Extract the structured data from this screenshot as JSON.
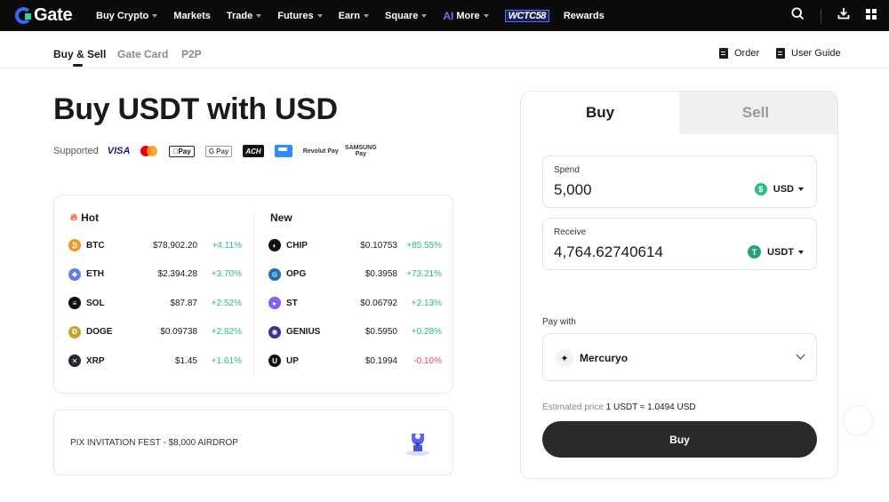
{
  "brand": {
    "name": "Gate"
  },
  "nav": {
    "items": [
      {
        "label": "Buy Crypto",
        "caret": true
      },
      {
        "label": "Markets",
        "caret": false
      },
      {
        "label": "Trade",
        "caret": true
      },
      {
        "label": "Futures",
        "caret": true
      },
      {
        "label": "Earn",
        "caret": true
      },
      {
        "label": "Square",
        "caret": true
      }
    ],
    "more_prefix": "AI",
    "more_label": "More",
    "wctc_label": "WCTC58",
    "rewards_label": "Rewards"
  },
  "tabs": {
    "buy_sell": "Buy & Sell",
    "gate_card": "Gate Card",
    "p2p": "P2P",
    "order": "Order",
    "user_guide": "User Guide"
  },
  "hero": {
    "title": "Buy USDT with USD",
    "supported_label": "Supported",
    "methods": [
      "VISA",
      "Mastercard",
      "Pay",
      "G Pay",
      "ACH",
      "Bank",
      "Revolut Pay",
      "SAMSUNG Pay"
    ]
  },
  "market": {
    "hot_label": "Hot",
    "new_label": "New",
    "hot": [
      {
        "symbol": "BTC",
        "price": "$78,902.20",
        "change": "+4.11%",
        "dir": "up",
        "color": "#f7931a",
        "glyph": "₿"
      },
      {
        "symbol": "ETH",
        "price": "$2,394.28",
        "change": "+3.70%",
        "dir": "up",
        "color": "#627eea",
        "glyph": "◆"
      },
      {
        "symbol": "SOL",
        "price": "$87.87",
        "change": "+2.52%",
        "dir": "up",
        "color": "#111111",
        "glyph": "≡"
      },
      {
        "symbol": "DOGE",
        "price": "$0.09738",
        "change": "+2.82%",
        "dir": "up",
        "color": "#c2a633",
        "glyph": "Ð"
      },
      {
        "symbol": "XRP",
        "price": "$1.45",
        "change": "+1.61%",
        "dir": "up",
        "color": "#23292f",
        "glyph": "✕"
      }
    ],
    "new": [
      {
        "symbol": "CHIP",
        "price": "$0.10753",
        "change": "+85.55%",
        "dir": "up",
        "color": "#111111",
        "glyph": "◐"
      },
      {
        "symbol": "OPG",
        "price": "$0.3958",
        "change": "+73.21%",
        "dir": "up",
        "color": "#1e6fb8",
        "glyph": "◎"
      },
      {
        "symbol": "ST",
        "price": "$0.06792",
        "change": "+2.13%",
        "dir": "up",
        "color": "#8a5cf6",
        "glyph": "▸"
      },
      {
        "symbol": "GENIUS",
        "price": "$0.5950",
        "change": "+0.28%",
        "dir": "up",
        "color": "#3b2f8f",
        "glyph": "◉"
      },
      {
        "symbol": "UP",
        "price": "$0.1994",
        "change": "-0.10%",
        "dir": "down",
        "color": "#111111",
        "glyph": "U"
      }
    ]
  },
  "promo": {
    "text": "PIX INVITATION FEST - $8,000 AIRDROP"
  },
  "trade": {
    "buy_tab": "Buy",
    "sell_tab": "Sell",
    "spend_label": "Spend",
    "spend_value": "5,000",
    "spend_currency": "USD",
    "receive_label": "Receive",
    "receive_value": "4,764.62740614",
    "receive_currency": "USDT",
    "pay_with_label": "Pay with",
    "provider": "Mercuryo",
    "estimated_label": "Estimated price",
    "estimated_value": "1 USDT ≈ 1.0494 USD",
    "buy_button": "Buy"
  },
  "colors": {
    "up": "#2ebd85",
    "down": "#f6465d",
    "brand_blue": "#2f6bff",
    "button_dark": "#2a2a2a"
  }
}
